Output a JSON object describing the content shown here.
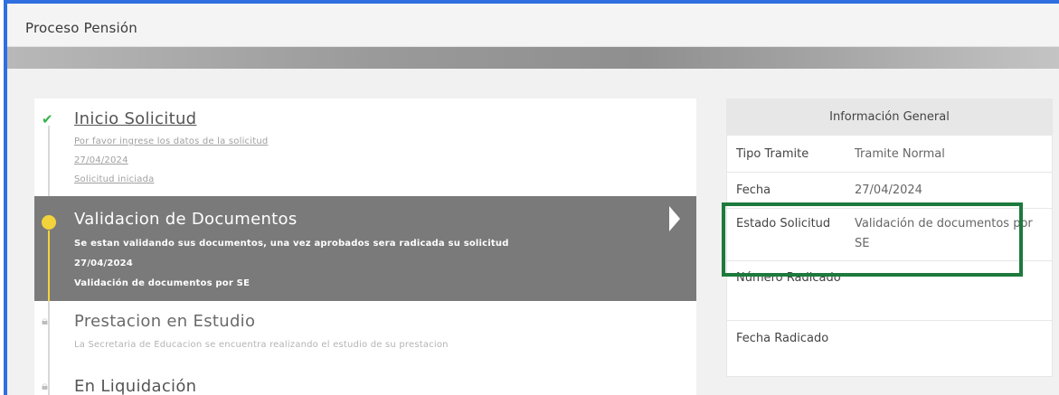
{
  "header": {
    "title": "Proceso Pensión"
  },
  "steps": [
    {
      "title": "Inicio Solicitud",
      "icon": "check-icon",
      "lines": [
        "Por favor ingrese los datos de la solicitud",
        "27/04/2024",
        "Solicitud iniciada"
      ]
    },
    {
      "title": "Validacion de Documentos",
      "icon": "current-dot-icon",
      "lines": [
        "Se estan validando sus documentos, una vez aprobados sera radicada su solicitud",
        "27/04/2024",
        "Validación de documentos por SE"
      ]
    },
    {
      "title": "Prestacion en Estudio",
      "icon": "lock-icon",
      "lines": [
        "La Secretaria de Educacion se encuentra realizando el estudio de su prestacion"
      ]
    },
    {
      "title": "En Liquidación",
      "icon": "lock-icon",
      "lines": []
    }
  ],
  "info": {
    "heading": "Información General",
    "rows": [
      {
        "label": "Tipo Tramite",
        "value": "Tramite Normal"
      },
      {
        "label": "Fecha",
        "value": "27/04/2024"
      },
      {
        "label": "Estado Solicitud",
        "value": "Validación de documentos por SE"
      },
      {
        "label": "Número Radicado",
        "value": ""
      },
      {
        "label": "Fecha Radicado",
        "value": ""
      }
    ]
  },
  "colors": {
    "frame_border": "#2f6fe0",
    "active_step": "#7a7a7a",
    "current_dot": "#f3d33b",
    "done_check": "#35b34a",
    "highlight_box": "#1d7a3c"
  }
}
